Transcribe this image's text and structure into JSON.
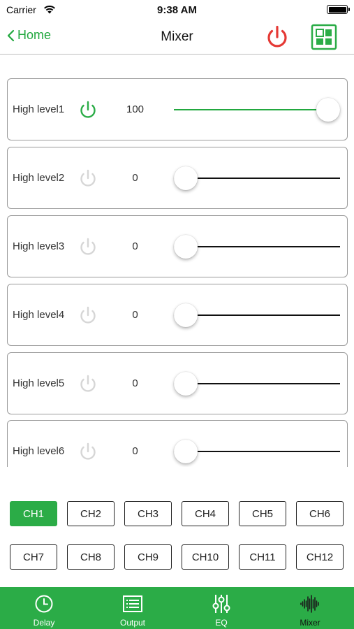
{
  "status": {
    "carrier": "Carrier",
    "time": "9:38 AM"
  },
  "nav": {
    "back_label": "Home",
    "title": "Mixer"
  },
  "colors": {
    "accent": "#2bac47",
    "power_on": "#2bac47",
    "power_off": "#d6d6d6",
    "power_header": "#e53935"
  },
  "rows": [
    {
      "label": "High level1",
      "value": "100",
      "on": true,
      "level": 1.0
    },
    {
      "label": "High level2",
      "value": "0",
      "on": false,
      "level": 0.0
    },
    {
      "label": "High level3",
      "value": "0",
      "on": false,
      "level": 0.0
    },
    {
      "label": "High level4",
      "value": "0",
      "on": false,
      "level": 0.0
    },
    {
      "label": "High level5",
      "value": "0",
      "on": false,
      "level": 0.0
    },
    {
      "label": "High level6",
      "value": "0",
      "on": false,
      "level": 0.0
    }
  ],
  "channels": [
    "CH1",
    "CH2",
    "CH3",
    "CH4",
    "CH5",
    "CH6",
    "CH7",
    "CH8",
    "CH9",
    "CH10",
    "CH11",
    "CH12"
  ],
  "active_channel": "CH1",
  "tabs": [
    {
      "label": "Delay",
      "icon": "clock-icon"
    },
    {
      "label": "Output",
      "icon": "list-icon"
    },
    {
      "label": "EQ",
      "icon": "equalizer-icon"
    },
    {
      "label": "Mixer",
      "icon": "waveform-icon"
    }
  ]
}
